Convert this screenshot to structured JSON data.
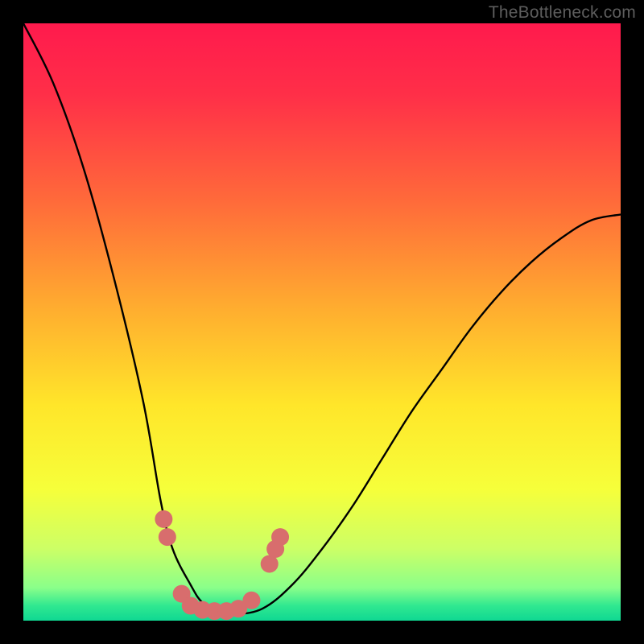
{
  "attribution": "TheBottleneck.com",
  "chart_data": {
    "type": "line",
    "title": "",
    "xlabel": "",
    "ylabel": "",
    "xlim": [
      0,
      100
    ],
    "ylim": [
      0,
      100
    ],
    "x": [
      0,
      5,
      10,
      15,
      20,
      23,
      25,
      28,
      30,
      33,
      35,
      40,
      45,
      50,
      55,
      60,
      65,
      70,
      75,
      80,
      85,
      90,
      95,
      100
    ],
    "values": [
      100,
      90,
      76,
      58,
      37,
      20,
      12,
      6,
      3,
      1,
      1,
      2,
      6,
      12,
      19,
      27,
      35,
      42,
      49,
      55,
      60,
      64,
      67,
      68
    ],
    "gradient_stops": [
      {
        "pos": 0.0,
        "color": "#ff1a4d"
      },
      {
        "pos": 0.12,
        "color": "#ff2f48"
      },
      {
        "pos": 0.3,
        "color": "#ff6b3a"
      },
      {
        "pos": 0.48,
        "color": "#ffae2f"
      },
      {
        "pos": 0.64,
        "color": "#ffe62a"
      },
      {
        "pos": 0.78,
        "color": "#f6ff3a"
      },
      {
        "pos": 0.88,
        "color": "#ccff66"
      },
      {
        "pos": 0.945,
        "color": "#8aff8a"
      },
      {
        "pos": 0.975,
        "color": "#30e890"
      },
      {
        "pos": 1.0,
        "color": "#0fd892"
      }
    ],
    "markers": {
      "color": "#d86d6d",
      "points": [
        {
          "x": 23.5,
          "y": 17
        },
        {
          "x": 24.1,
          "y": 14
        },
        {
          "x": 26.5,
          "y": 4.5
        },
        {
          "x": 28.0,
          "y": 2.5
        },
        {
          "x": 30.0,
          "y": 1.8
        },
        {
          "x": 32.0,
          "y": 1.6
        },
        {
          "x": 34.0,
          "y": 1.6
        },
        {
          "x": 36.0,
          "y": 2.0
        },
        {
          "x": 38.2,
          "y": 3.4
        },
        {
          "x": 41.2,
          "y": 9.5
        },
        {
          "x": 42.2,
          "y": 12
        },
        {
          "x": 43.0,
          "y": 14
        }
      ]
    }
  }
}
